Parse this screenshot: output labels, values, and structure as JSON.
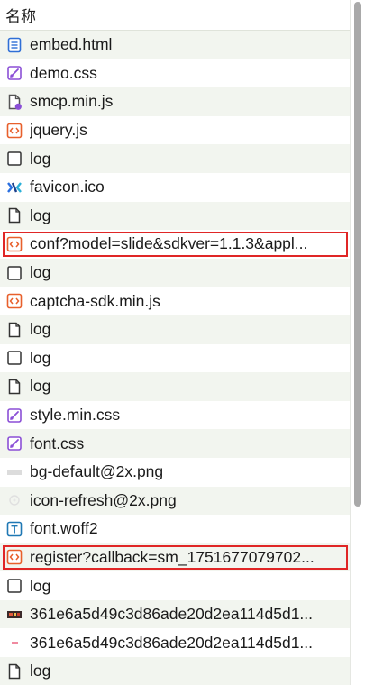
{
  "header": {
    "name_column": "名称"
  },
  "colors": {
    "highlight_border": "#e02626",
    "row_alt": "#f2f5ef",
    "doc_icon": "#2f6fd6",
    "css_icon": "#8b4fd6",
    "script_icon": "#e8602c",
    "font_icon": "#1f78b4"
  },
  "files": [
    {
      "name": "embed.html",
      "icon": "document-icon"
    },
    {
      "name": "demo.css",
      "icon": "stylesheet-icon"
    },
    {
      "name": "smcp.min.js",
      "icon": "script-file-icon"
    },
    {
      "name": "jquery.js",
      "icon": "code-icon"
    },
    {
      "name": "log",
      "icon": "blank-icon"
    },
    {
      "name": "favicon.ico",
      "icon": "favicon-icon"
    },
    {
      "name": "log",
      "icon": "file-icon"
    },
    {
      "name": "conf?model=slide&sdkver=1.1.3&appl...",
      "icon": "code-icon",
      "highlighted": true
    },
    {
      "name": "log",
      "icon": "blank-icon"
    },
    {
      "name": "captcha-sdk.min.js",
      "icon": "code-icon"
    },
    {
      "name": "log",
      "icon": "file-icon"
    },
    {
      "name": "log",
      "icon": "blank-icon"
    },
    {
      "name": "log",
      "icon": "file-icon"
    },
    {
      "name": "style.min.css",
      "icon": "stylesheet-icon"
    },
    {
      "name": "font.css",
      "icon": "stylesheet-icon"
    },
    {
      "name": "bg-default@2x.png",
      "icon": "image-bar-icon"
    },
    {
      "name": "icon-refresh@2x.png",
      "icon": "image-faint-icon"
    },
    {
      "name": "font.woff2",
      "icon": "font-icon"
    },
    {
      "name": "register?callback=sm_1751677079702...",
      "icon": "code-icon",
      "highlighted": true
    },
    {
      "name": "log",
      "icon": "blank-icon"
    },
    {
      "name": "361e6a5d49c3d86ade20d2ea114d5d1...",
      "icon": "image-thumb-icon"
    },
    {
      "name": "361e6a5d49c3d86ade20d2ea114d5d1...",
      "icon": "image-dash-icon"
    },
    {
      "name": "log",
      "icon": "file-icon"
    }
  ]
}
